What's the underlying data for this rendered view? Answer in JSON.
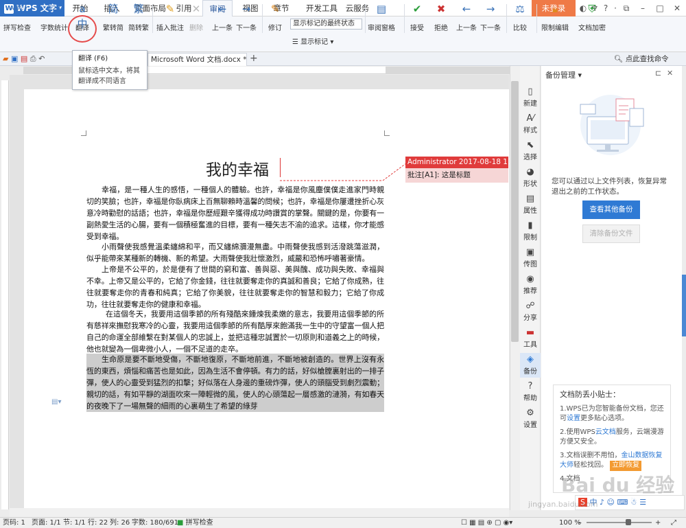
{
  "app": {
    "name": "WPS 文字"
  },
  "menu": {
    "tabs": [
      "开始",
      "插入",
      "页面布局",
      "引用",
      "审阅",
      "视图",
      "章节",
      "开发工具",
      "云服务"
    ],
    "active": "审阅",
    "login": "未登录"
  },
  "ribbon": {
    "spell_check": "拼写检查",
    "word_count": "字数统计",
    "translate": "翻译",
    "trad_to_simp": "繁转简",
    "simp_to_trad": "简转繁",
    "insert_comment": "插入批注",
    "delete": "删除",
    "prev": "上一条",
    "next": "下一条",
    "track": "修订",
    "show_markup_select": "显示标记的最终状态",
    "show_markup": "显示标记",
    "review_pane": "审阅窗格",
    "accept": "接受",
    "reject": "拒绝",
    "prev2": "上一条",
    "next2": "下一条",
    "compare": "比较",
    "restrict_edit": "限制编辑",
    "doc_encrypt": "文档加密"
  },
  "tooltip": {
    "title": "翻译 (F6)",
    "body": "鼠标选中文本，将其翻译成不同语言"
  },
  "doc_tab": {
    "name": "Microsoft Word 文档.docx *",
    "add": "+"
  },
  "search_cmd": "点此查找命令",
  "document": {
    "title": "我的幸福",
    "paragraphs": [
      "幸福，是一種人生的感悟，一種個人的體驗。也許，幸福是你風塵僕僕走進家門時親切的笑臉；也許，幸福是你臥病床上百無聊賴時溫馨的問候；也許，幸福是你屢遭挫折心灰意冷時勸慰的話語；也許，幸福是你歷經艱辛獲得成功時讚賞的掌聲。關鍵的是，你要有一副熱愛生活的心腸，要有一個積極奮進的目標，要有一種矢志不渝的追求。這樣，你才能感受到幸福。",
      "小雨聲使我感覺溫柔纏綿和平，而又纏綿瀰漫無盡。中雨聲使我感到活潑跳蕩滋潤，似乎能帶來某種新的轉機、新的希望。大雨聲使我壯懷激烈，威嚴和恐怖呼嘯著豪情。",
      "上帝是不公平的，於是便有了世間的窮和富、善與惡、美與醜、成功與失敗、幸福與不幸。上帝又是公平的，它給了你金錢，往往就要奪走你的真誠和善良；它給了你成熟，往往就要奪走你的青春和純真；它給了你美貌，往往就要奪走你的智慧和毅力；它給了你成功，往往就要奪走你的健康和幸福。",
      "在這個冬天，我要用這個季節的所有殘酷來鍾煉我柔嫩的意志，我要用這個季節的所有慈祥來撫慰我寒冷的心靈，我要用這個季節的所有酷厚來飽滿我一生中的守望富一個人把自己的命運全部維繫在對某個人的忠誠上，並把這種忠誠置於一切原則和道義之上的時候，他也就變為一個卑微小人，一個不足道的走卒。",
      "生命原是要不斷地受傷，不斷地復原，不斷地前進，不斷地被創造的。世界上沒有永恆的東西，煩惱和痛苦也是如此，因為生活不會停頓。有力的話，好似槍膛裏射出的一排子彈，使人的心靈受到猛烈的扣擊；好似落在人身邊的重磅炸彈，使人的頭腦受到劇烈震動；親切的話，有如平靜的湖面吹來一陣輕微的風，使人的心頭蕩起一層感激的漣漪，有如春天的夜晚下了一場無聲的細雨的心裏萌生了希望的綠芽"
    ],
    "cursor_note": ""
  },
  "comment": {
    "header": "Administrator 2017-08-18 11:28",
    "body": "批注[A1]: 这是标题"
  },
  "sidebar_tools": [
    "新建",
    "样式",
    "选择",
    "形状",
    "属性",
    "限制",
    "传图",
    "推荐",
    "分享",
    "工具",
    "备份",
    "帮助",
    "设置"
  ],
  "sidebar_active": "备份",
  "panel": {
    "title": "备份管理",
    "desc": "您可以通过以上文件列表，恢复异常退出之前的工作状态。",
    "btn_view": "查看其他备份",
    "btn_clear": "清除备份文件",
    "tips_title": "文档防丢小贴士：",
    "tip1a": "1.WPS已为您智能备份文档，您还可",
    "tip1b": "设置",
    "tip1c": "更多贴心选项。",
    "tip2a": "2.使用WPS",
    "tip2b": "云文档",
    "tip2c": "服务，云端漫游方便又安全。",
    "tip3a": "3.文档误删不用怕，",
    "tip3b": "金山数据恢复大师",
    "tip3c": "轻松找回。",
    "tip3d": "立即恢复",
    "tip4": "4.文档"
  },
  "status": {
    "page_num": "页码: 1",
    "page": "页面: 1/1",
    "section": "节: 1/1",
    "row": "行: 22",
    "col": "列: 26",
    "words": "字数: 180/691",
    "spell": "拼写检查",
    "zoom": "100 %"
  },
  "watermark": {
    "brand": "Bai du 经验",
    "url": "jingyan.baidu.com"
  },
  "ime": "中 ♪ ☺ ⌨ ☃ ☰"
}
